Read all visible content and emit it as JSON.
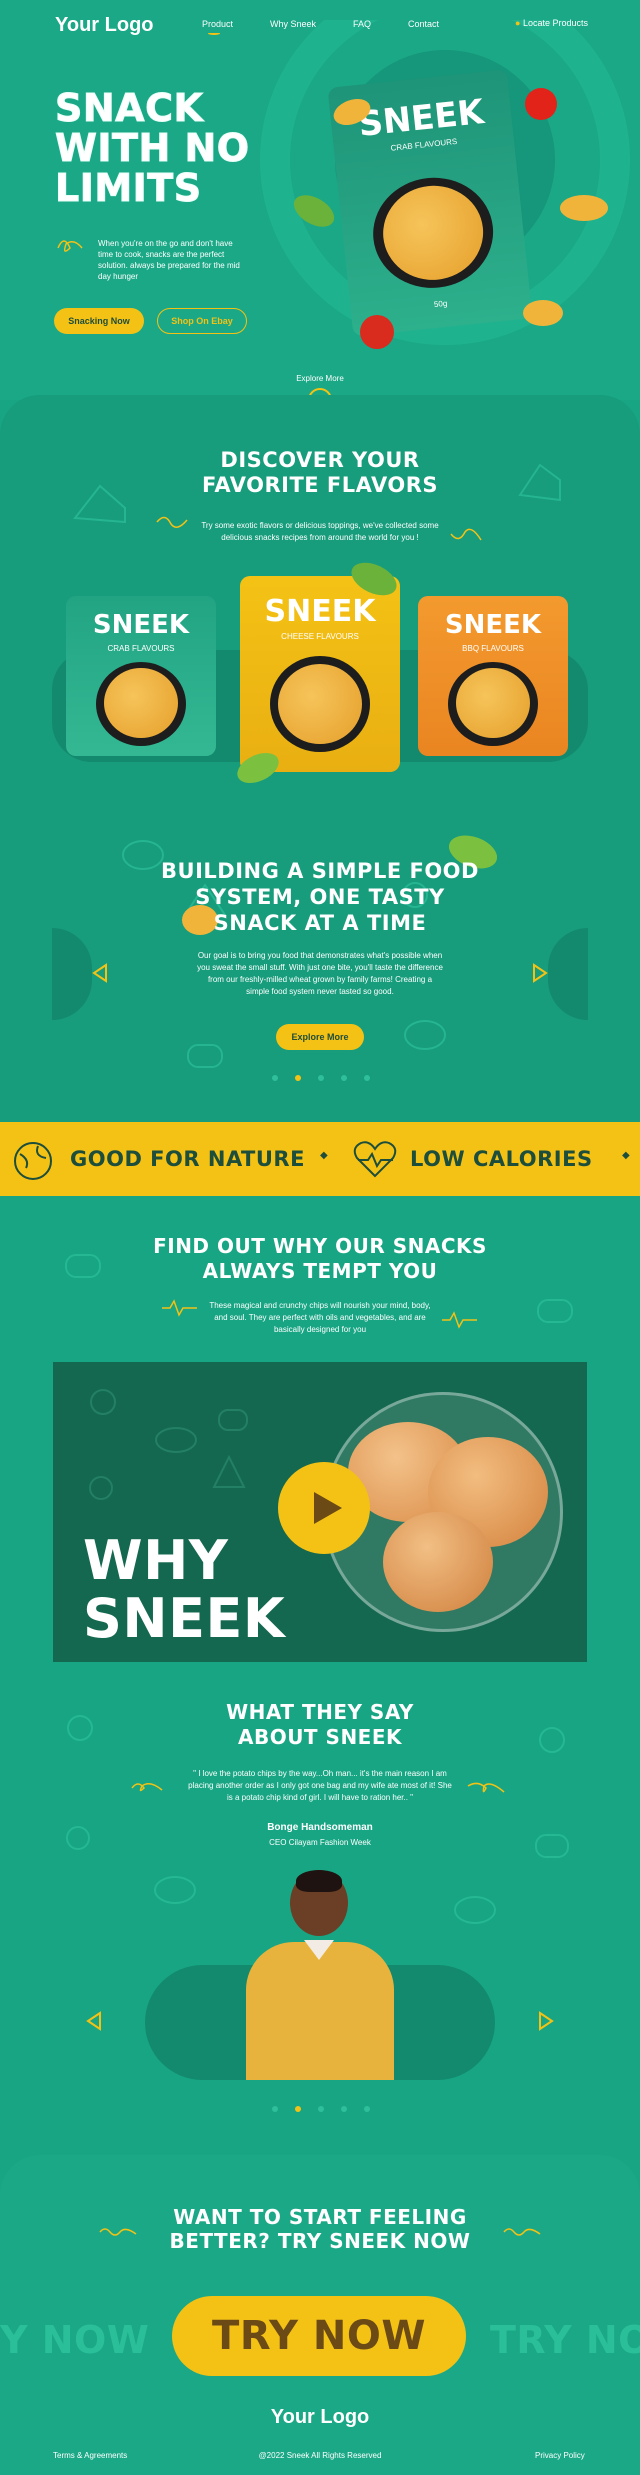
{
  "header": {
    "logo": "Your Logo",
    "nav": [
      "Product",
      "Why Sneek",
      "FAQ",
      "Contact"
    ],
    "locate": "Locate Products"
  },
  "hero": {
    "title_lines": [
      "SNACK",
      "WITH NO",
      "LIMITS"
    ],
    "description": "When you're on the go and don't have time to cook, snacks are the perfect solution. always be prepared for the mid day hunger",
    "btn_primary": "Snacking Now",
    "btn_secondary": "Shop On Ebay",
    "explore": "Explore More",
    "bag": {
      "brand": "SNEEK",
      "flavor": "CRAB FLAVOURS",
      "weight": "50g"
    }
  },
  "discover": {
    "title_lines": [
      "DISCOVER YOUR",
      "FAVORITE FLAVORS"
    ],
    "description": "Try some exotic flavors or delicious toppings, we've collected some delicious snacks recipes from around the world for you !",
    "bags": [
      {
        "brand": "SNEEK",
        "flavor": "CRAB FLAVOURS"
      },
      {
        "brand": "SNEEK",
        "flavor": "CHEESE FLAVOURS"
      },
      {
        "brand": "SNEEK",
        "flavor": "BBQ FLAVOURS"
      }
    ]
  },
  "building": {
    "title_lines": [
      "BUILDING A SIMPLE FOOD",
      "SYSTEM, ONE TASTY",
      "SNACK AT A TIME"
    ],
    "description": "Our goal is to bring you food that demonstrates what's possible when you sweat the small stuff. With just one bite, you'll taste the difference from our freshly-milled wheat grown by family farms! Creating a simple food system never tasted so good.",
    "button": "Explore More"
  },
  "strip": {
    "items": [
      "GOOD FOR NATURE",
      "LOW CALORIES"
    ]
  },
  "why": {
    "title_lines": [
      "FIND OUT WHY OUR SNACKS",
      "ALWAYS TEMPT YOU"
    ],
    "description": "These magical and crunchy chips will nourish your mind, body, and soul. They are perfect with oils and vegetables, and are basically designed for you",
    "video_text_lines": [
      "WHY",
      "SNEEK"
    ]
  },
  "testimonial": {
    "title_lines": [
      "WHAT THEY SAY",
      "ABOUT SNEEK"
    ],
    "quote": "\" I love the potato chips by the way...Oh man... it's the main reason I am placing another order as I only got one bag and my wife ate most of it! She is a potato chip kind of girl. I will have to ration her.. \"",
    "name": "Bonge Handsomeman",
    "role": "CEO Cilayam Fashion Week"
  },
  "cta": {
    "title_lines": [
      "WANT TO START FEELING",
      "BETTER? TRY SNEEK NOW"
    ],
    "button": "TRY NOW",
    "ghost_left": "Y NOW",
    "ghost_right": "TRY NO"
  },
  "footer": {
    "logo": "Your Logo",
    "left": "Terms & Agreements",
    "center": "@2022 Sneek All Rights Reserved",
    "right": "Privacy Policy"
  },
  "colors": {
    "green": "#17a583",
    "yellow": "#f4c215",
    "dark": "#1d4d3b",
    "orange": "#f0912a"
  }
}
